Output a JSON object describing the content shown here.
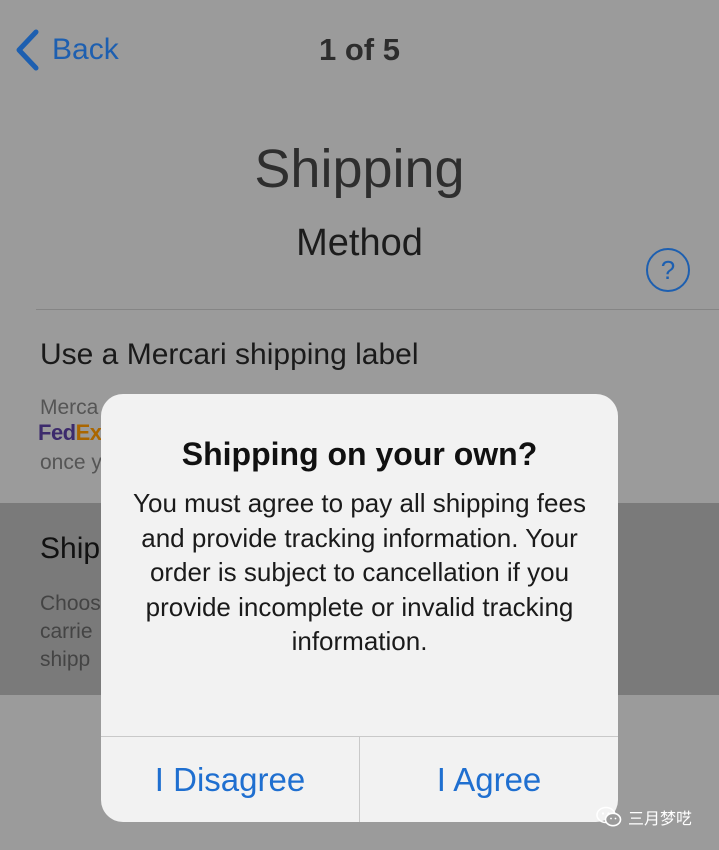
{
  "nav": {
    "back_label": "Back",
    "title": "1 of 5"
  },
  "header": {
    "title": "Shipping",
    "subtitle": "Method",
    "help_glyph": "?"
  },
  "options": {
    "mercari": {
      "title": "Use a Mercari shipping label",
      "desc_line1": "Merca",
      "logo_fed": "Fed",
      "logo_ex": "Ex",
      "desc_line3": "once y"
    },
    "own": {
      "title": "Ship",
      "desc_lines": [
        "Choos",
        "carrie",
        "shipp"
      ]
    }
  },
  "alert": {
    "title": "Shipping on your own?",
    "message": "You must agree to pay all shipping fees and provide tracking information. Your order is subject to cancellation if you provide incomplete or invalid tracking information.",
    "disagree_label": "I Disagree",
    "agree_label": "I Agree"
  },
  "watermark": {
    "text": "三月梦呓"
  },
  "colors": {
    "accent": "#1d5fb0",
    "button_text": "#1f6fd0",
    "dim_background": "#9b9b9b",
    "selected_band": "#7a7a7a",
    "alert_background": "#f2f2f2"
  },
  "icons": [
    "chevron-left-icon",
    "help-icon",
    "wechat-icon"
  ]
}
